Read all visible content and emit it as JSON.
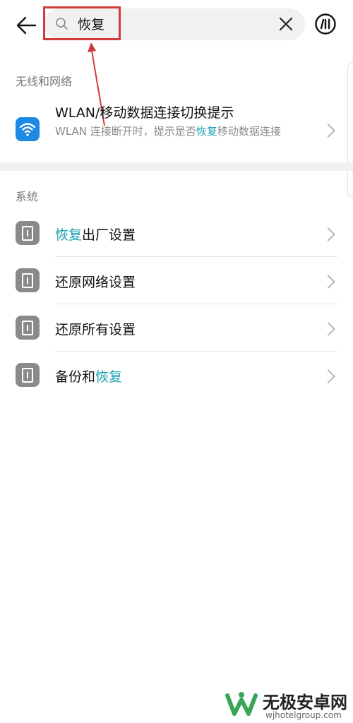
{
  "search": {
    "query": "恢复"
  },
  "sections": [
    {
      "header": "无线和网络"
    },
    {
      "header": "系统"
    }
  ],
  "wlan": {
    "title": "WLAN/移动数据连接切换提示",
    "sub_pre": "WLAN 连接断开时，提示是否",
    "sub_hl": "恢复",
    "sub_post": "移动数据连接"
  },
  "system_items": [
    {
      "pre": "",
      "hl": "恢复",
      "post": "出厂设置"
    },
    {
      "pre": "还原网络设置",
      "hl": "",
      "post": ""
    },
    {
      "pre": "还原所有设置",
      "hl": "",
      "post": ""
    },
    {
      "pre": "备份和",
      "hl": "恢复",
      "post": ""
    }
  ],
  "watermark": {
    "title": "无极安卓网",
    "url": "wjhotelgroup.com"
  },
  "colors": {
    "highlight": "#1aa0b4",
    "annotation": "#d23a3a",
    "wifi_icon_bg": "#1e88e5"
  }
}
